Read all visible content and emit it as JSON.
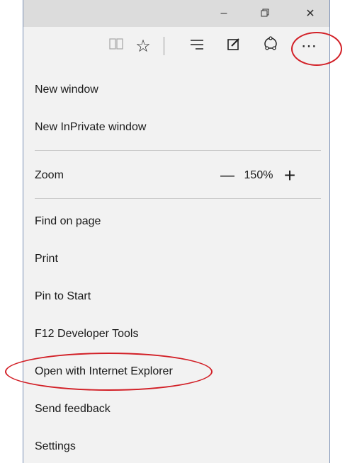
{
  "window_controls": {
    "minimize": "–",
    "restore": "❐",
    "close": "✕"
  },
  "toolbar": {
    "icons": [
      "reading-view-icon",
      "favorite-star-icon",
      "hub-icon",
      "web-note-icon",
      "share-icon",
      "more-actions-icon"
    ],
    "reading_glyph": "🕮",
    "star_glyph": "☆",
    "hub_glyph": "≣",
    "note_glyph": "✐",
    "share_glyph": "↻",
    "more_glyph": "⋯"
  },
  "menu": {
    "new_window": "New window",
    "new_inprivate": "New InPrivate window",
    "zoom_label": "Zoom",
    "zoom_minus": "—",
    "zoom_value": "150%",
    "zoom_plus": "+",
    "find_on_page": "Find on page",
    "print": "Print",
    "pin_to_start": "Pin to Start",
    "dev_tools": "F12 Developer Tools",
    "open_ie": "Open with Internet Explorer",
    "send_feedback": "Send feedback",
    "settings": "Settings"
  },
  "colors": {
    "annotation": "#d21f26",
    "titlebar": "#dcdcdc",
    "menu_bg": "#f2f2f2",
    "border": "#7a8fb5"
  }
}
